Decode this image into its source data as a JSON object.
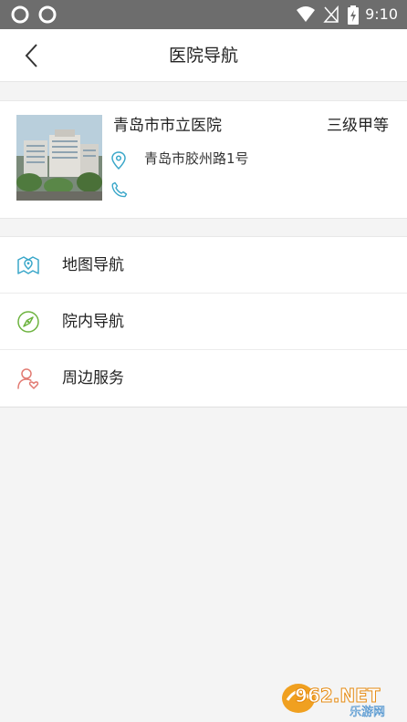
{
  "status_bar": {
    "time": "9:10"
  },
  "header": {
    "title": "医院导航"
  },
  "hospital": {
    "name": "青岛市市立医院",
    "level": "三级甲等",
    "address": "青岛市胶州路1号"
  },
  "menu": {
    "items": [
      {
        "label": "地图导航",
        "icon": "map-pin-icon",
        "color": "#3aa7c9"
      },
      {
        "label": "院内导航",
        "icon": "compass-icon",
        "color": "#6db33f"
      },
      {
        "label": "周边服务",
        "icon": "person-heart-icon",
        "color": "#e27a72"
      }
    ]
  },
  "watermark": {
    "text_main": "962.NET",
    "text_sub": "乐游网"
  }
}
